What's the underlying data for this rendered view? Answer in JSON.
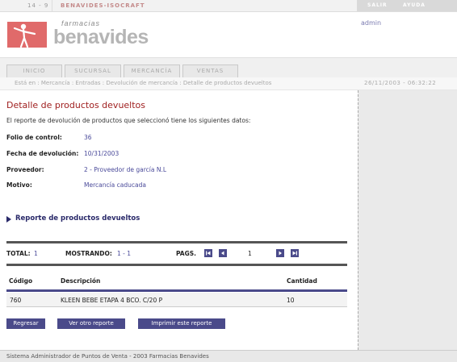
{
  "topbar": {
    "code": "14 - 9",
    "app_name": "BENAVIDES-ISOCRAFT",
    "exit_label": "SALIR",
    "help_label": "AYUDA"
  },
  "header": {
    "logo_small": "farmacias",
    "logo_big": "benavides",
    "user": "admin"
  },
  "nav": {
    "tabs": [
      {
        "label": "INICIO"
      },
      {
        "label": "SUCURSAL"
      },
      {
        "label": "MERCANCÍA"
      },
      {
        "label": "VENTAS"
      }
    ]
  },
  "breadcrumb": "Está en : Mercancía : Entradas : Devolución de mercancía : Detalle de productos devueltos",
  "datetime": "26/11/2003 - 06:32:22",
  "main": {
    "title": "Detalle de productos devueltos",
    "intro": "El reporte de devolución de productos que seleccionó tiene los siguientes datos:",
    "fields": [
      {
        "label": "Folio de control:",
        "value": "36"
      },
      {
        "label": "Fecha de devolución:",
        "value": "10/31/2003"
      },
      {
        "label": "Proveedor:",
        "value": "2 - Proveedor de garcía N.L"
      },
      {
        "label": "Motivo:",
        "value": "Mercancía caducada"
      }
    ],
    "report_link": "Reporte de productos devueltos"
  },
  "pagination": {
    "total_label": "TOTAL:",
    "total_value": "1",
    "showing_label": "MOSTRANDO:",
    "showing_value": "1 - 1",
    "pages_label": "PAGS.",
    "current_page": "1"
  },
  "table": {
    "headers": [
      "Código",
      "Descripción",
      "Cantidad"
    ],
    "rows": [
      [
        "760",
        "KLEEN BEBE ETAPA 4 BCO. C/20 P",
        "10"
      ]
    ]
  },
  "actions": {
    "back": "Regresar",
    "other": "Ver otro reporte",
    "print": "Imprimir este reporte"
  },
  "footer": "Sistema Administrador de Puntos de Venta - 2003 Farmacias Benavides"
}
